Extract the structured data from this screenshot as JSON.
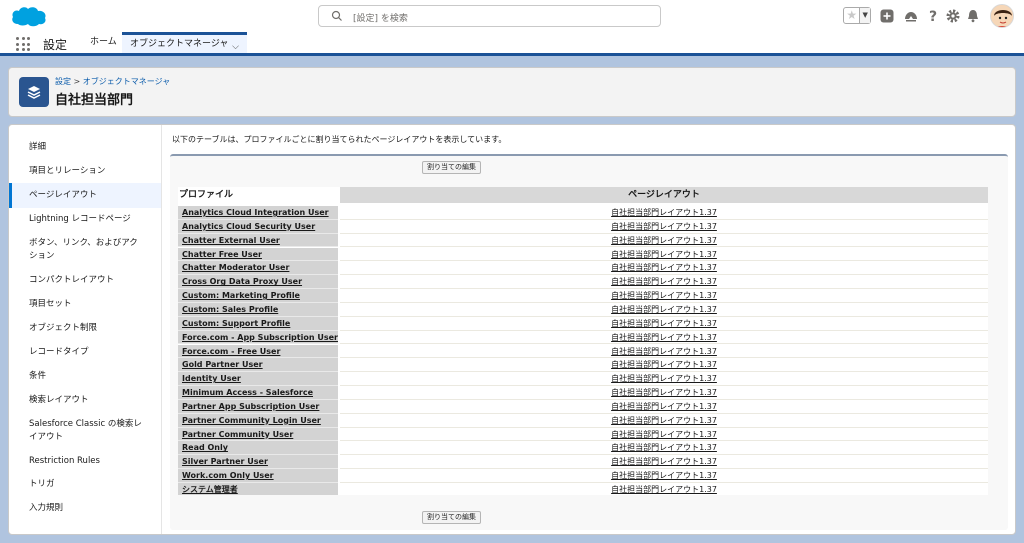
{
  "header": {
    "search_placeholder": "[設定] を検索"
  },
  "nav": {
    "app_name": "設定",
    "tabs": [
      {
        "label": "ホーム"
      },
      {
        "label": "オブジェクトマネージャ"
      }
    ]
  },
  "page": {
    "breadcrumb": {
      "root": "設定",
      "separator": ">",
      "current": "オブジェクトマネージャ"
    },
    "title": "自社担当部門"
  },
  "sidebar": {
    "items": [
      {
        "label": "詳細"
      },
      {
        "label": "項目とリレーション"
      },
      {
        "label": "ページレイアウト"
      },
      {
        "label": "Lightning レコードページ"
      },
      {
        "label": "ボタン、リンク、およびアクション"
      },
      {
        "label": "コンパクトレイアウト"
      },
      {
        "label": "項目セット"
      },
      {
        "label": "オブジェクト制限"
      },
      {
        "label": "レコードタイプ"
      },
      {
        "label": "条件"
      },
      {
        "label": "検索レイアウト"
      },
      {
        "label": "Salesforce Classic の検索レイアウト"
      },
      {
        "label": "Restriction Rules"
      },
      {
        "label": "トリガ"
      },
      {
        "label": "入力規則"
      }
    ],
    "active_index": 2
  },
  "main": {
    "description": "以下のテーブルは、プロファイルごとに割り当てられたページレイアウトを表示しています。",
    "assign_button_label": "割り当ての編集",
    "table": {
      "col_profile": "プロファイル",
      "col_layout": "ページレイアウト",
      "rows": [
        {
          "profile": "Analytics Cloud Integration User",
          "layout": "自社担当部門レイアウト1.37"
        },
        {
          "profile": "Analytics Cloud Security User",
          "layout": "自社担当部門レイアウト1.37"
        },
        {
          "profile": "Chatter External User",
          "layout": "自社担当部門レイアウト1.37"
        },
        {
          "profile": "Chatter Free User",
          "layout": "自社担当部門レイアウト1.37"
        },
        {
          "profile": "Chatter Moderator User",
          "layout": "自社担当部門レイアウト1.37"
        },
        {
          "profile": "Cross Org Data Proxy User",
          "layout": "自社担当部門レイアウト1.37"
        },
        {
          "profile": "Custom: Marketing Profile",
          "layout": "自社担当部門レイアウト1.37"
        },
        {
          "profile": "Custom: Sales Profile",
          "layout": "自社担当部門レイアウト1.37"
        },
        {
          "profile": "Custom: Support Profile",
          "layout": "自社担当部門レイアウト1.37"
        },
        {
          "profile": "Force.com - App Subscription User",
          "layout": "自社担当部門レイアウト1.37"
        },
        {
          "profile": "Force.com - Free User",
          "layout": "自社担当部門レイアウト1.37"
        },
        {
          "profile": "Gold Partner User",
          "layout": "自社担当部門レイアウト1.37"
        },
        {
          "profile": "Identity User",
          "layout": "自社担当部門レイアウト1.37"
        },
        {
          "profile": "Minimum Access - Salesforce",
          "layout": "自社担当部門レイアウト1.37"
        },
        {
          "profile": "Partner App Subscription User",
          "layout": "自社担当部門レイアウト1.37"
        },
        {
          "profile": "Partner Community Login User",
          "layout": "自社担当部門レイアウト1.37"
        },
        {
          "profile": "Partner Community User",
          "layout": "自社担当部門レイアウト1.37"
        },
        {
          "profile": "Read Only",
          "layout": "自社担当部門レイアウト1.37"
        },
        {
          "profile": "Silver Partner User",
          "layout": "自社担当部門レイアウト1.37"
        },
        {
          "profile": "Work.com Only User",
          "layout": "自社担当部門レイアウト1.37"
        },
        {
          "profile": "システム管理者",
          "layout": "自社担当部門レイアウト1.37"
        }
      ]
    }
  },
  "colors": {
    "brand_blue": "#1b5297",
    "link_blue": "#0b5cab",
    "background": "#b0c4df"
  },
  "icons": [
    "salesforce-cloud-logo",
    "search-icon",
    "star-icon",
    "chevron-down-icon",
    "add-icon",
    "trailhead-icon",
    "help-icon",
    "gear-icon",
    "bell-icon",
    "app-launcher-icon",
    "layers-icon"
  ]
}
